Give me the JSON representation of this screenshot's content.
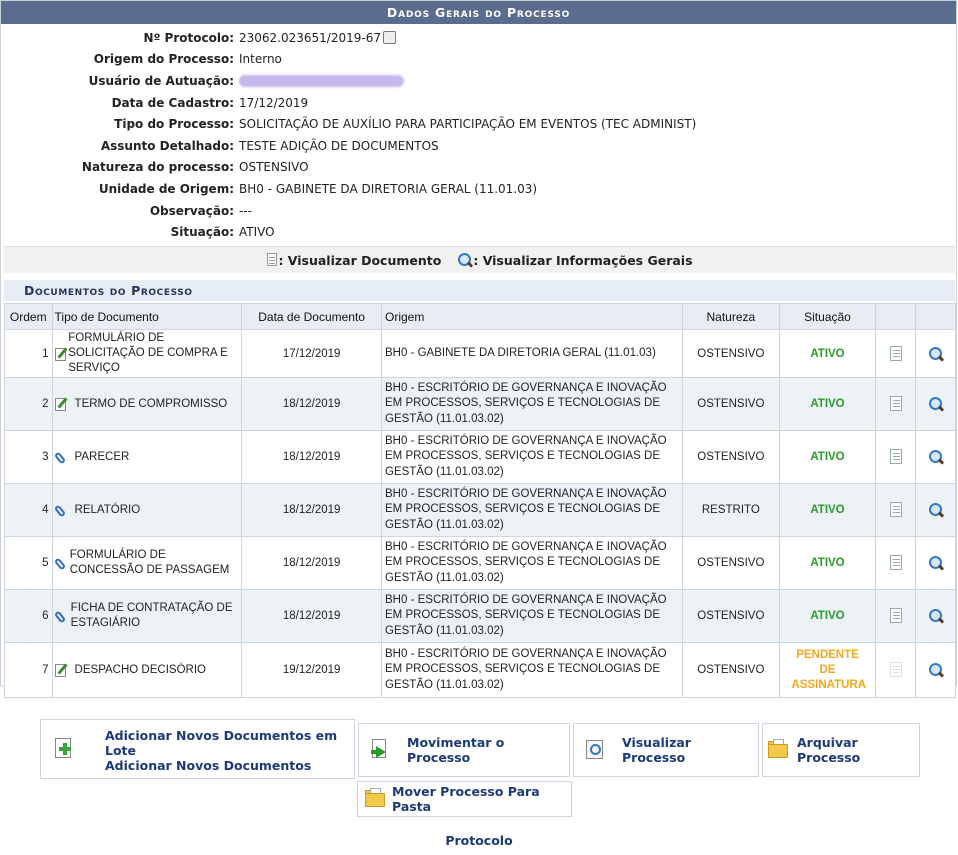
{
  "header": {
    "title": "Dados Gerais do Processo"
  },
  "info": [
    {
      "label": "Nº Protocolo:",
      "value": "23062.023651/2019-67",
      "printer": true
    },
    {
      "label": "Origem do Processo:",
      "value": "Interno"
    },
    {
      "label": "Usuário de Autuação:",
      "value": "",
      "redacted": true
    },
    {
      "label": "Data de Cadastro:",
      "value": "17/12/2019"
    },
    {
      "label": "Tipo do Processo:",
      "value": "SOLICITAÇÃO DE AUXÍLIO PARA PARTICIPAÇÃO EM EVENTOS (TEC ADMINIST)"
    },
    {
      "label": "Assunto Detalhado:",
      "value": "TESTE ADIÇÃO DE DOCUMENTOS"
    },
    {
      "label": "Natureza do processo:",
      "value": "OSTENSIVO"
    },
    {
      "label": "Unidade de Origem:",
      "value": "BH0 - GABINETE DA DIRETORIA GERAL (11.01.03)"
    },
    {
      "label": "Observação:",
      "value": "---"
    },
    {
      "label": "Situação:",
      "value": "ATIVO"
    }
  ],
  "legend": {
    "view_doc": ": Visualizar Documento",
    "view_info": ": Visualizar Informações Gerais"
  },
  "docs_section": {
    "title": "Documentos do Processo",
    "columns": [
      "Ordem",
      "Tipo de Documento",
      "Data de Documento",
      "Origem",
      "Natureza",
      "Situação"
    ],
    "rows": [
      {
        "ordem": "1",
        "icon": "pen",
        "tipo": "FORMULÁRIO DE SOLICITAÇÃO DE COMPRA E SERVIÇO",
        "data": "17/12/2019",
        "origem": "BH0 - GABINETE DA DIRETORIA GERAL (11.01.03)",
        "natureza": "OSTENSIVO",
        "situacao": "ATIVO",
        "status": "ativo"
      },
      {
        "ordem": "2",
        "icon": "pen",
        "tipo": "TERMO DE COMPROMISSO",
        "data": "18/12/2019",
        "origem": "BH0 - ESCRITÓRIO DE GOVERNANÇA E INOVAÇÃO EM PROCESSOS, SERVIÇOS E TECNOLOGIAS DE GESTÃO (11.01.03.02)",
        "natureza": "OSTENSIVO",
        "situacao": "ATIVO",
        "status": "ativo"
      },
      {
        "ordem": "3",
        "icon": "clip",
        "tipo": "PARECER",
        "data": "18/12/2019",
        "origem": "BH0 - ESCRITÓRIO DE GOVERNANÇA E INOVAÇÃO EM PROCESSOS, SERVIÇOS E TECNOLOGIAS DE GESTÃO (11.01.03.02)",
        "natureza": "OSTENSIVO",
        "situacao": "ATIVO",
        "status": "ativo"
      },
      {
        "ordem": "4",
        "icon": "clip",
        "tipo": "RELATÓRIO",
        "data": "18/12/2019",
        "origem": "BH0 - ESCRITÓRIO DE GOVERNANÇA E INOVAÇÃO EM PROCESSOS, SERVIÇOS E TECNOLOGIAS DE GESTÃO (11.01.03.02)",
        "natureza": "RESTRITO",
        "situacao": "ATIVO",
        "status": "ativo"
      },
      {
        "ordem": "5",
        "icon": "clip",
        "tipo": "FORMULÁRIO DE CONCESSÃO DE PASSAGEM",
        "data": "18/12/2019",
        "origem": "BH0 - ESCRITÓRIO DE GOVERNANÇA E INOVAÇÃO EM PROCESSOS, SERVIÇOS E TECNOLOGIAS DE GESTÃO (11.01.03.02)",
        "natureza": "OSTENSIVO",
        "situacao": "ATIVO",
        "status": "ativo"
      },
      {
        "ordem": "6",
        "icon": "clip",
        "tipo": "FICHA DE CONTRATAÇÃO DE ESTAGIÁRIO",
        "data": "18/12/2019",
        "origem": "BH0 - ESCRITÓRIO DE GOVERNANÇA E INOVAÇÃO EM PROCESSOS, SERVIÇOS E TECNOLOGIAS DE GESTÃO (11.01.03.02)",
        "natureza": "OSTENSIVO",
        "situacao": "ATIVO",
        "status": "ativo"
      },
      {
        "ordem": "7",
        "icon": "pen",
        "tipo": "DESPACHO DECISÓRIO",
        "data": "19/12/2019",
        "origem": "BH0 - ESCRITÓRIO DE GOVERNANÇA E INOVAÇÃO EM PROCESSOS, SERVIÇOS E TECNOLOGIAS DE GESTÃO (11.01.03.02)",
        "natureza": "OSTENSIVO",
        "situacao": "PENDENTE DE ASSINATURA",
        "status": "pendente"
      }
    ]
  },
  "actions": {
    "add_batch": "Adicionar Novos Documentos em Lote",
    "add_docs": "Adicionar Novos Documentos",
    "move": "Movimentar o Processo",
    "view": "Visualizar Processo",
    "archive": "Arquivar Processo",
    "move_folder": "Mover Processo Para Pasta"
  },
  "footer": {
    "link": "Protocolo"
  },
  "colors": {
    "header_bg": "#5b6d8f",
    "status_active": "#2a9a2a",
    "status_pending": "#f0a820",
    "link": "#1c3a7a"
  }
}
